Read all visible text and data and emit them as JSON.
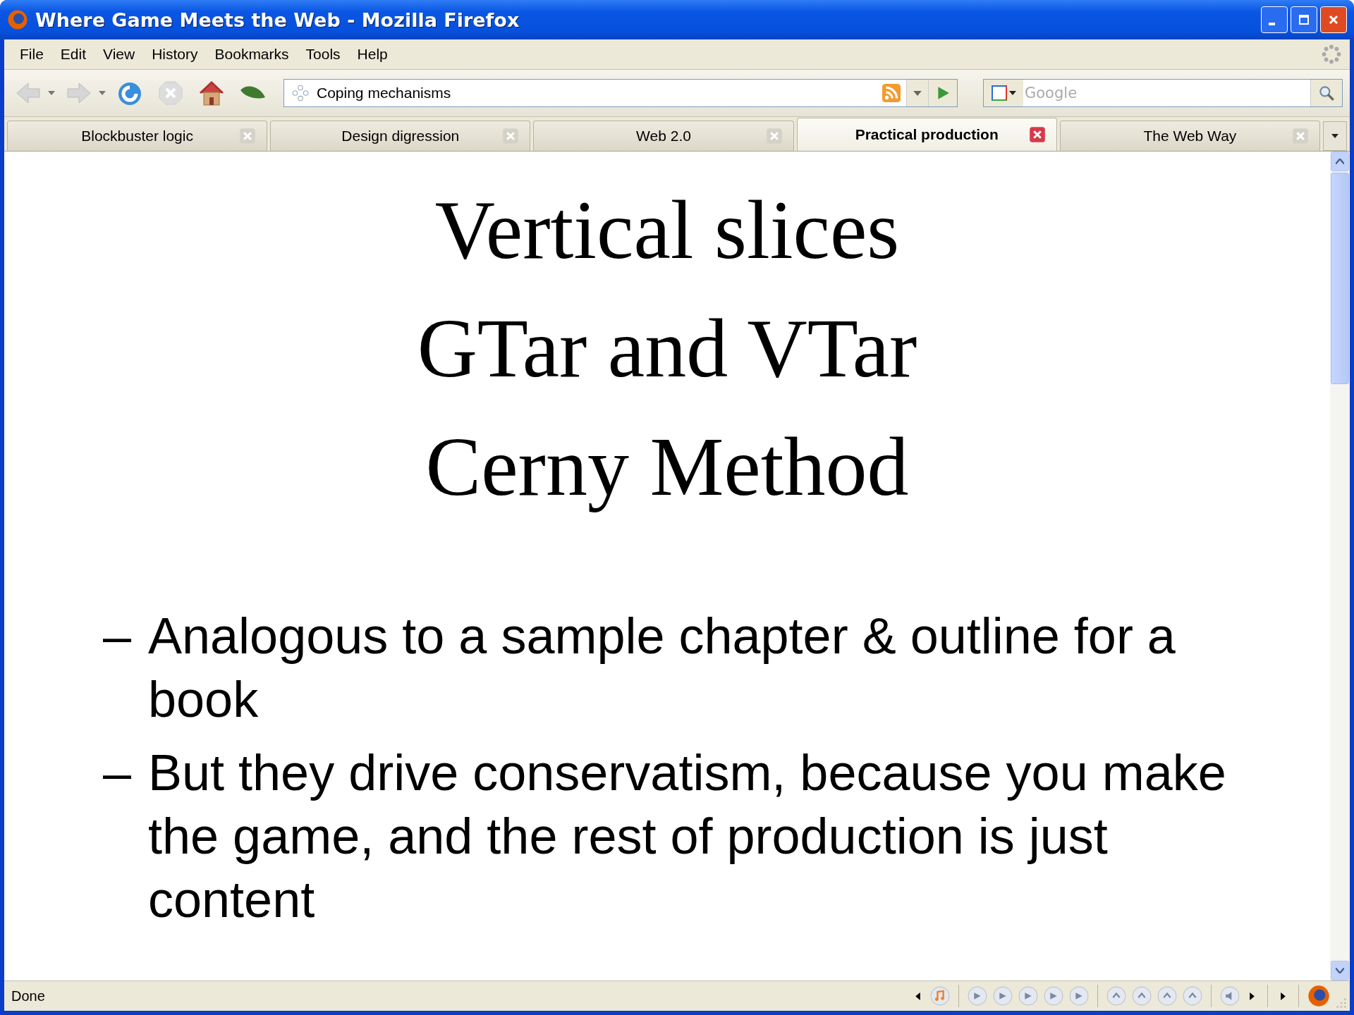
{
  "window": {
    "title": "Where Game Meets the Web - Mozilla Firefox"
  },
  "menu": [
    "File",
    "Edit",
    "View",
    "History",
    "Bookmarks",
    "Tools",
    "Help"
  ],
  "toolbar": {
    "address": "Coping mechanisms",
    "search": {
      "placeholder": "Google"
    }
  },
  "tabs": [
    {
      "label": "Blockbuster logic",
      "selected": false
    },
    {
      "label": "Design digression",
      "selected": false
    },
    {
      "label": "Web 2.0",
      "selected": false
    },
    {
      "label": "Practical production",
      "selected": true
    },
    {
      "label": "The Web Way",
      "selected": false
    }
  ],
  "slide": {
    "headings": [
      "Vertical slices",
      "GTar and VTar",
      "Cerny Method"
    ],
    "bullets": [
      {
        "marker": "–",
        "text": "Analogous to a sample chapter & outline for a book"
      },
      {
        "marker": "–",
        "text": "But they drive conservatism, because you make the game, and the rest of production is just content"
      }
    ]
  },
  "status_bar": {
    "text": "Done"
  }
}
